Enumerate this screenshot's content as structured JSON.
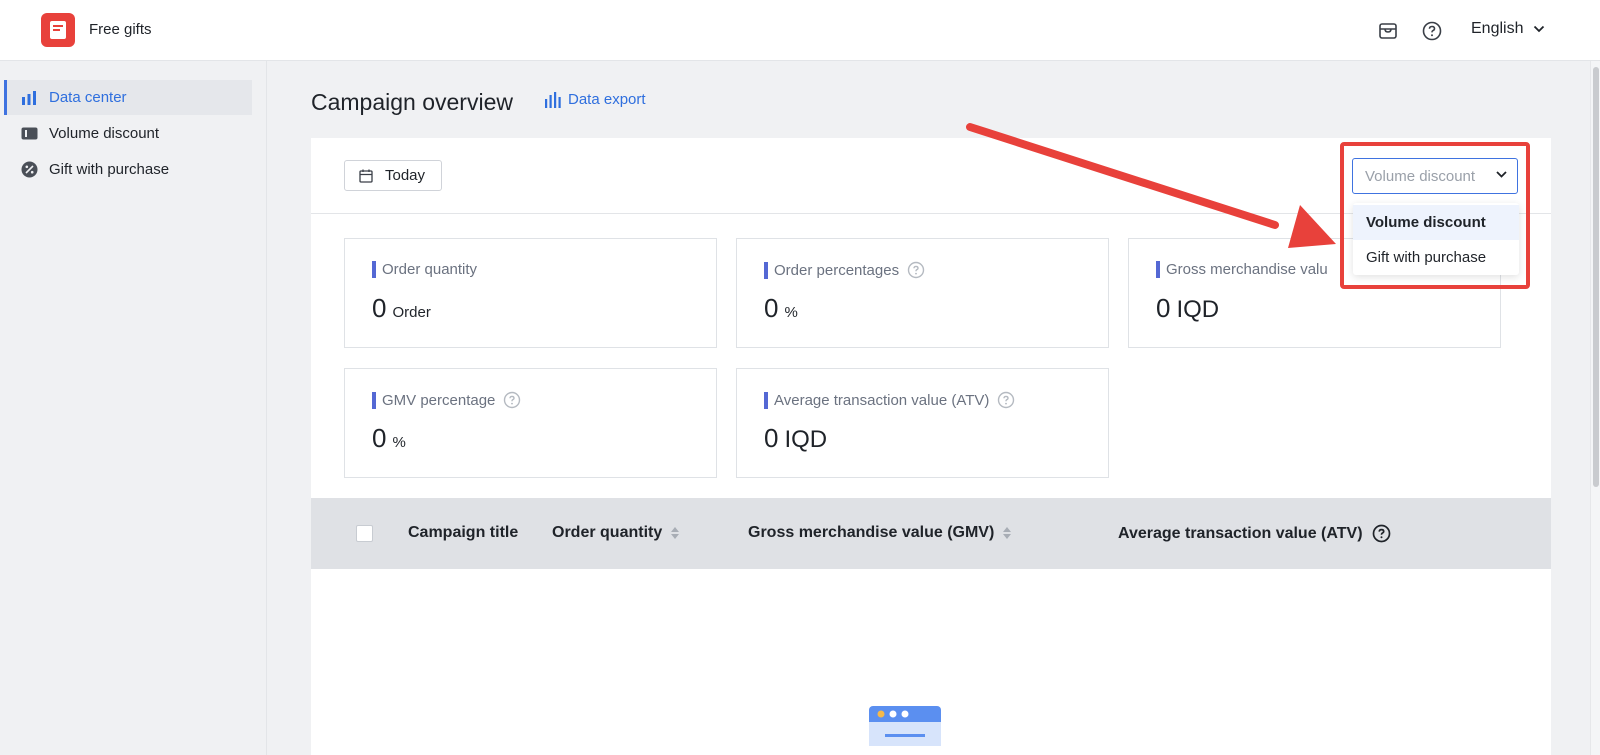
{
  "header": {
    "app_title": "Free gifts",
    "language": "English"
  },
  "sidebar": {
    "items": [
      {
        "label": "Data center",
        "icon": "bar-chart-icon",
        "active": true
      },
      {
        "label": "Volume discount",
        "icon": "ticket-icon",
        "active": false
      },
      {
        "label": "Gift with purchase",
        "icon": "discount-badge-icon",
        "active": false
      }
    ]
  },
  "main": {
    "title": "Campaign overview",
    "export_label": "Data export",
    "date_filter": "Today",
    "campaign_type_select": {
      "value": "Volume discount",
      "options": [
        "Volume discount",
        "Gift with purchase"
      ],
      "selected": "Volume discount"
    },
    "metrics": [
      {
        "label": "Order quantity",
        "value": "0",
        "unit": "Order",
        "has_help": false
      },
      {
        "label": "Order percentages",
        "value": "0",
        "unit": "%",
        "has_help": true
      },
      {
        "label": "Gross merchandise value (GMV)",
        "visible_label": "Gross merchandise valu",
        "value": "0",
        "unit": "IQD",
        "has_help": false
      },
      {
        "label": "GMV percentage",
        "value": "0",
        "unit": "%",
        "has_help": true
      },
      {
        "label": "Average transaction value (ATV)",
        "value": "0",
        "unit": "IQD",
        "has_help": true
      }
    ],
    "table": {
      "columns": [
        "Campaign title",
        "Order quantity",
        "Gross merchandise value (GMV)",
        "Average transaction value (ATV)"
      ]
    }
  },
  "colors": {
    "accent": "#2f6fde",
    "brand": "#e8413b",
    "metric_bar": "#5468d4",
    "annotation": "#e8413b"
  }
}
